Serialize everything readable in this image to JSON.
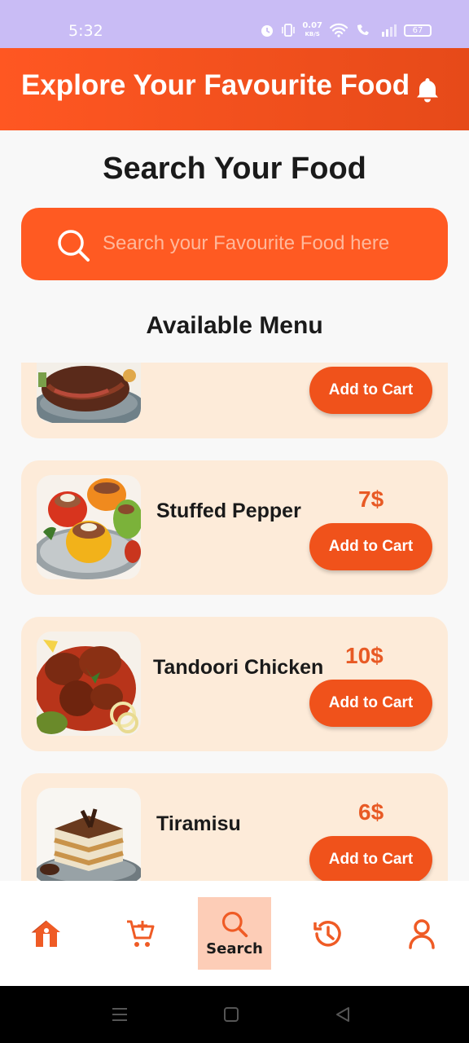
{
  "status_bar": {
    "time": "5:32",
    "speed_value": "0.07",
    "speed_unit": "KB/S",
    "battery": "67"
  },
  "header": {
    "title": "Explore Your Favourite Food",
    "notification_icon": "bell-icon"
  },
  "search": {
    "title": "Search Your Food",
    "placeholder": "Search your Favourite Food here"
  },
  "menu": {
    "title": "Available Menu",
    "items": [
      {
        "name": "",
        "price": "",
        "button": "Add to Cart",
        "image": "steak"
      },
      {
        "name": "Stuffed Pepper",
        "price": "7$",
        "button": "Add to Cart",
        "image": "stuffed-pepper"
      },
      {
        "name": "Tandoori Chicken",
        "price": "10$",
        "button": "Add to Cart",
        "image": "tandoori-chicken"
      },
      {
        "name": "Tiramisu",
        "price": "6$",
        "button": "Add to Cart",
        "image": "tiramisu"
      }
    ]
  },
  "bottom_nav": {
    "items": [
      {
        "icon": "home-icon",
        "label": ""
      },
      {
        "icon": "cart-add-icon",
        "label": ""
      },
      {
        "icon": "search-icon",
        "label": "Search",
        "active": true
      },
      {
        "icon": "history-icon",
        "label": ""
      },
      {
        "icon": "profile-icon",
        "label": ""
      }
    ]
  },
  "colors": {
    "accent": "#ff5722",
    "card_bg": "#fdebd9",
    "price": "#e85a25",
    "status_bar": "#c9bcf5"
  }
}
